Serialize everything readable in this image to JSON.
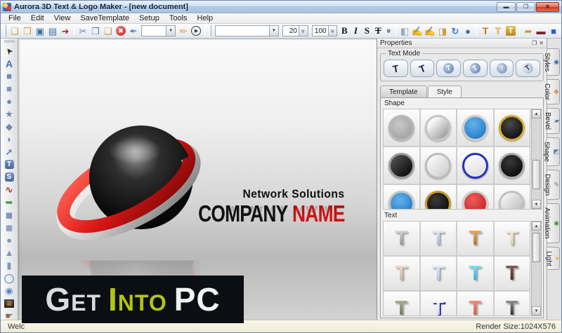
{
  "window": {
    "title": "Aurora 3D Text & Logo Maker - [new document]",
    "minimize": "▬",
    "restore": "❐",
    "close": "✕"
  },
  "menu": {
    "items": [
      "File",
      "Edit",
      "View",
      "SaveTemplate",
      "Setup",
      "Tools",
      "Help"
    ]
  },
  "toolbar": {
    "icons_file": [
      {
        "name": "new-document-icon",
        "glyph": "❏",
        "style": "color:#c9a23a"
      },
      {
        "name": "open-folder-icon",
        "glyph": "❒",
        "style": "color:#e0972f"
      },
      {
        "name": "save-icon",
        "glyph": "▣",
        "style": "color:#3a6fb0"
      },
      {
        "name": "save-as-icon",
        "glyph": "▤",
        "style": "color:#3a6fb0"
      },
      {
        "name": "export-icon",
        "glyph": "➜",
        "style": "color:#b02828"
      }
    ],
    "icons_edit": [
      {
        "name": "cut-icon",
        "glyph": "✂",
        "style": "color:#5b7db1"
      },
      {
        "name": "copy-icon",
        "glyph": "❐",
        "style": "color:#5b7db1"
      },
      {
        "name": "paste-icon",
        "glyph": "❑",
        "style": "color:#c8963a"
      },
      {
        "name": "delete-icon",
        "glyph": "✖",
        "style": "background:radial-gradient(circle at 35% 30%,#ee7a7a,#c21f1f);color:#fff;border-radius:50%;font-size:9px;width:14px;height:14px"
      },
      {
        "name": "style-brush-icon",
        "glyph": "✒",
        "style": "color:#4a86c8"
      }
    ],
    "combo1_value": "",
    "icons_draw": [
      {
        "name": "edit-pencil-icon",
        "glyph": "✏",
        "style": "color:#e0a030"
      },
      {
        "name": "play-animation-icon",
        "glyph": "▶",
        "style": "border:1.5px solid #3a3a3a;border-radius:50%;color:#3a3a3a;font-size:7px;width:14px;height:14px;padding-left:1px"
      }
    ],
    "combo2_value": "",
    "font_size": "20",
    "scale_percent": "100",
    "format_buttons": [
      {
        "name": "bold-button",
        "label": "B",
        "style": "color:#111"
      },
      {
        "name": "italic-button",
        "label": "I",
        "style": "color:#111;font-style:italic"
      },
      {
        "name": "shadow-button",
        "label": "S",
        "style": "color:#111"
      },
      {
        "name": "strike-button",
        "label": "T",
        "style": "color:#111;text-decoration:line-through"
      }
    ],
    "icons_3d": [
      {
        "name": "cube-edit-icon",
        "glyph": "◧",
        "style": "color:#98a8bc"
      },
      {
        "name": "shape-edit-icon",
        "glyph": "✍",
        "style": "color:#9a7040"
      },
      {
        "name": "node-edit-icon",
        "glyph": "✍",
        "style": "color:#8a6a50"
      },
      {
        "name": "gold-cube-icon",
        "glyph": "◨",
        "style": "color:#c8a030"
      },
      {
        "name": "refresh-icon",
        "glyph": "↻",
        "style": "color:#3a86c8;font-weight:bold"
      },
      {
        "name": "cylinder-icon",
        "glyph": "●",
        "style": "color:#3a6fb0"
      }
    ],
    "icons_text3d": [
      {
        "name": "text-3d-icon",
        "glyph": "T",
        "style": "color:#c87818;font-weight:bold;font-size:14px"
      },
      {
        "name": "text-outline-icon",
        "glyph": "T",
        "style": "color:#e8b878;font-weight:bold;font-size:14px;text-shadow:0 0 1px #c87818"
      },
      {
        "name": "text-box-icon",
        "glyph": "T",
        "style": "background:linear-gradient(#e8c050,#b88820);color:#fff;font-weight:bold;font-size:11px;border-radius:2px;width:14px;height:14px"
      }
    ],
    "icons_extra": [
      {
        "name": "snap-icon",
        "glyph": "➦",
        "style": "color:#c8a020"
      },
      {
        "name": "dark-shape-icon",
        "glyph": "▬",
        "style": "color:#7a2424"
      },
      {
        "name": "blue-square-icon",
        "glyph": "■",
        "style": "color:#2a5fc8"
      }
    ]
  },
  "left_tools": [
    {
      "name": "select-tool",
      "glyph": "➤",
      "style": "color:#2a2a2a;transform:rotate(-128deg);font-size:12px"
    },
    {
      "name": "text-tool",
      "glyph": "A",
      "style": "color:#3a6fb0;font-weight:bold;font-size:14px"
    },
    {
      "name": "rectangle-tool",
      "glyph": "■",
      "style": "color:#6d89b8"
    },
    {
      "name": "rounded-rect-tool",
      "glyph": "■",
      "style": "color:#7d95c0;border-radius:4px"
    },
    {
      "name": "ellipse-tool",
      "glyph": "●",
      "style": "color:#6d89b8"
    },
    {
      "name": "star-tool",
      "glyph": "★",
      "style": "color:#6d89b8"
    },
    {
      "name": "polygon-tool",
      "glyph": "◆",
      "style": "color:#6d89b8"
    },
    {
      "name": "pie-tool",
      "glyph": "◗",
      "style": "color:#6d89b8"
    },
    {
      "name": "arrow-tool",
      "glyph": "➚",
      "style": "color:#6d89b8;font-weight:bold"
    },
    {
      "name": "text-frame-tool",
      "glyph": "T",
      "style": "background:linear-gradient(#7d96bd,#44679c);color:#fff;border-radius:3px;font-size:10px;font-weight:bold;width:13px;height:13px"
    },
    {
      "name": "symbol-frame-tool",
      "glyph": "S",
      "style": "background:linear-gradient(#7d96bd,#44679c);color:#fff;border-radius:3px;font-size:10px;font-weight:bold;width:13px;height:13px"
    },
    {
      "name": "freehand-tool",
      "glyph": "∿",
      "style": "color:#c03030;font-weight:bold"
    },
    {
      "name": "import-tool",
      "glyph": "➥",
      "style": "color:#3a9a3a"
    },
    {
      "name": "cube-tool",
      "glyph": "◼",
      "style": "color:#7d96bd"
    },
    {
      "name": "rounded-cube-tool",
      "glyph": "◼",
      "style": "color:#8fa5c5;border-radius:4px"
    },
    {
      "name": "sphere-tool",
      "glyph": "●",
      "style": "color:#7d96bd"
    },
    {
      "name": "cone-tool",
      "glyph": "▲",
      "style": "color:#7d96bd"
    },
    {
      "name": "cylinder-tool",
      "glyph": "▮",
      "style": "color:#7d96bd"
    },
    {
      "name": "torus-tool",
      "glyph": "◯",
      "style": "color:#7d96bd;font-weight:bold"
    },
    {
      "name": "sphere2-tool",
      "glyph": "◉",
      "style": "color:#5b85c0"
    },
    {
      "name": "image-tool",
      "glyph": "▦",
      "style": "background:linear-gradient(#4a4a4a,#222);color:#cc8833;font-size:9px;width:14px;height:12px"
    },
    {
      "name": "gesture-tool",
      "glyph": "☛",
      "style": "color:#8a6a50"
    }
  ],
  "canvas": {
    "subtitle": "Network Solutions",
    "company_word1": "COMPANY",
    "company_word2": "NAME",
    "logo": {
      "sphere_hi": "#8c8c8c",
      "sphere_mid": "#2e2e2e",
      "sphere_dark": "#000000",
      "ring_red_light": "#ff6a5a",
      "ring_red": "#e01818",
      "ring_red_dark": "#7a0606",
      "ring_silver_light": "#ffffff",
      "ring_silver": "#c8c8c8",
      "ring_silver_dark": "#7e7e7e"
    }
  },
  "watermark": {
    "get": "Get",
    "into": "Into",
    "pc": "PC"
  },
  "properties": {
    "title": "Properties",
    "float_icon": "❐",
    "close_icon": "✕",
    "text_mode_label": "Text Mode",
    "text_modes": [
      {
        "name": "text-mode-flat-button",
        "glyph": "T",
        "style": "color:#17243f;transform:rotate(-10deg);font-size:14px"
      },
      {
        "name": "text-mode-flat2-button",
        "glyph": "T",
        "style": "color:#17243f;transform:rotate(-22deg);font-size:14px"
      },
      {
        "name": "text-mode-round-button",
        "glyph": "T",
        "style": "background:radial-gradient(circle at 35% 30%,#b9cde8,#5f7da8);color:#fff;border-radius:50%;width:15px;height:15px;font-size:10px;transform:rotate(-12deg)"
      },
      {
        "name": "text-mode-round2-button",
        "glyph": "T",
        "style": "background:radial-gradient(circle at 35% 30%,#b9cde8,#5f7da8);color:#fff;border-radius:50%;width:15px;height:15px;font-size:10px;transform:rotate(-30deg)"
      },
      {
        "name": "text-mode-round3-button",
        "glyph": "T",
        "style": "background:radial-gradient(circle at 35% 30%,#c4d5ec,#748fb4);color:#eee;border-radius:50%;width:15px;height:15px;font-size:9px;transform:rotate(-8deg)"
      },
      {
        "name": "text-mode-round4-button",
        "glyph": "T",
        "style": "background:radial-gradient(circle at 35% 30%,#e8eef6,#9ab0cc);color:#334;border-radius:50%;width:15px;height:15px;font-size:10px;transform:rotate(-35deg)"
      }
    ],
    "tabs": {
      "template": "Template",
      "style": "Style"
    },
    "shape_label": "Shape",
    "text_label": "Text",
    "shapes": [
      {
        "name": "shape-thumbnail",
        "style": "background:radial-gradient(circle at 40% 35%,#c9c9c9,#989898);border-color:#b8b8b8"
      },
      {
        "name": "shape-thumbnail",
        "style": "background:linear-gradient(135deg,#fafafa 20%,#8e8e8e);border-color:#c6c6c6"
      },
      {
        "name": "shape-thumbnail",
        "style": "background:radial-gradient(circle at 40% 32%,#62b2ea,#176fc0);border-color:#cccccc"
      },
      {
        "name": "shape-thumbnail",
        "style": "background:radial-gradient(circle at 40% 32%,#484848,#000);border-color:#d8a828"
      },
      {
        "name": "shape-thumbnail",
        "style": "background:linear-gradient(135deg,#5a5a5a,#000);border-color:#9c9c9c"
      },
      {
        "name": "shape-thumbnail",
        "style": "background:linear-gradient(135deg,#ffffff,#c8c8c8);border-color:#bdbdbd"
      },
      {
        "name": "shape-thumbnail",
        "style": "background:linear-gradient(160deg,#ffffff,#dcdcdc);border-color:#2233bb"
      },
      {
        "name": "shape-thumbnail",
        "style": "background:radial-gradient(circle at 40% 32%,#383838,#000);border-color:#aaaaaa"
      },
      {
        "name": "shape-thumbnail",
        "style": "background:radial-gradient(circle at 40% 32%,#62b2ea,#176fc0);border-color:#c6c6c6"
      },
      {
        "name": "shape-thumbnail",
        "style": "background:radial-gradient(circle at 40% 32%,#3a3a3a,#000);border-color:#c89828"
      },
      {
        "name": "shape-thumbnail",
        "style": "background:radial-gradient(circle at 40% 32%,#ee5c5c,#bc1616);border-color:#cccccc"
      },
      {
        "name": "shape-thumbnail",
        "style": "background:linear-gradient(135deg,#fcfcfc,#b4b4b4);border-color:#c2c2c2"
      }
    ],
    "texts": [
      {
        "name": "text-style-thumbnail",
        "glyph": "T",
        "style": "background-image:linear-gradient(#e0e0e0,#828282)"
      },
      {
        "name": "text-style-thumbnail",
        "glyph": "T",
        "style": "background-image:linear-gradient(#eef3f8,#96aec8)"
      },
      {
        "name": "text-style-thumbnail",
        "glyph": "T",
        "style": "background-image:linear-gradient(#f4b264,#a86014)"
      },
      {
        "name": "text-style-thumbnail",
        "glyph": "T",
        "style": "background-image:linear-gradient(#faf2e2,#d6c5a4)"
      },
      {
        "name": "text-style-thumbnail",
        "glyph": "T",
        "style": "background-image:linear-gradient(#f2e2ca,#c4ac88)"
      },
      {
        "name": "text-style-thumbnail",
        "glyph": "T",
        "style": "background-image:linear-gradient(#ecf2fa,#a4b6d0)"
      },
      {
        "name": "text-style-thumbnail",
        "glyph": "T",
        "style": "background-image:linear-gradient(#8ceafa,#12a6d2)"
      },
      {
        "name": "text-style-thumbnail",
        "glyph": "T",
        "style": "background-image:linear-gradient(#8a6058,#381c14)"
      },
      {
        "name": "text-style-thumbnail",
        "glyph": "T",
        "style": "background-image:linear-gradient(#aab890,#5e6e48)"
      },
      {
        "name": "text-style-thumbnail",
        "glyph": "T",
        "style": "background-image:linear-gradient(#ffffff,#c9cede);filter:drop-shadow(2px 2px 0 #2424bc)"
      },
      {
        "name": "text-style-thumbnail",
        "glyph": "T",
        "style": "background-image:linear-gradient(#f29480,#cc4c34)"
      },
      {
        "name": "text-style-thumbnail",
        "glyph": "T",
        "style": "background-image:linear-gradient(#9c9c9c,#141414)"
      }
    ]
  },
  "side_tabs": [
    {
      "name": "tab-styles",
      "label": "Styles",
      "glyph": "◉",
      "icstyle": "color:#2f6fc0"
    },
    {
      "name": "tab-color",
      "label": "Color",
      "glyph": "❖",
      "icstyle": "color:#e07818"
    },
    {
      "name": "tab-bevel",
      "label": "Bevel",
      "glyph": "▰",
      "icstyle": "color:#5b7db1"
    },
    {
      "name": "tab-shape",
      "label": "Shape",
      "glyph": "◩",
      "icstyle": "color:#5b7db1"
    },
    {
      "name": "tab-design",
      "label": "Design",
      "glyph": "✎",
      "icstyle": "color:#887766"
    },
    {
      "name": "tab-animation",
      "label": "Animation",
      "glyph": "◉",
      "icstyle": "color:#2fa02f"
    },
    {
      "name": "tab-light",
      "label": "Light",
      "glyph": "●",
      "icstyle": "color:#e8c020"
    }
  ],
  "status": {
    "left": "Welc",
    "right": "Render Size:1024X576"
  }
}
